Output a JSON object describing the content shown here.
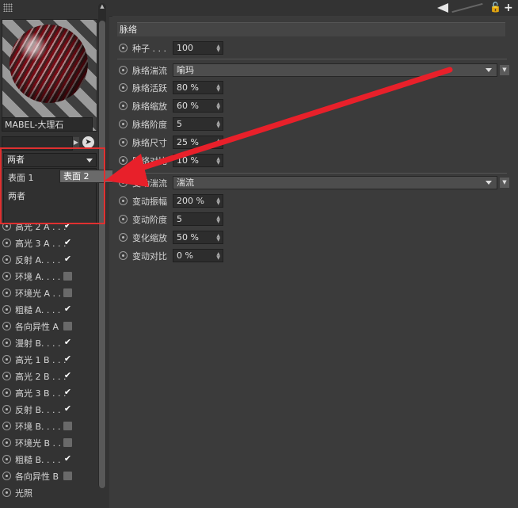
{
  "material": {
    "name": "MABEL-大理石"
  },
  "dropdown": {
    "value": "两者",
    "options": [
      {
        "label": "表面 1",
        "selected": false
      },
      {
        "label": "表面 2",
        "selected": true
      },
      {
        "label": "两者",
        "selected": false
      }
    ]
  },
  "channels": [
    {
      "label": "高光 2 A . . .",
      "checked": true
    },
    {
      "label": "高光 3 A . . .",
      "checked": true
    },
    {
      "label": "反射 A. . . .",
      "checked": true
    },
    {
      "label": "环境 A. . . .",
      "checked": false
    },
    {
      "label": "环境光 A . .",
      "checked": false
    },
    {
      "label": "粗糙 A. . . .",
      "checked": true
    },
    {
      "label": "各向异性 A",
      "checked": false
    },
    {
      "label": "漫射 B. . . .",
      "checked": true
    },
    {
      "label": "高光 1 B . . .",
      "checked": true
    },
    {
      "label": "高光 2 B . . .",
      "checked": true
    },
    {
      "label": "高光 3 B . . .",
      "checked": true
    },
    {
      "label": "反射 B. . . .",
      "checked": true
    },
    {
      "label": "环境 B. . . .",
      "checked": false
    },
    {
      "label": "环境光 B . .",
      "checked": false
    },
    {
      "label": "粗糙 B. . . .",
      "checked": true
    },
    {
      "label": "各向异性 B",
      "checked": false
    },
    {
      "label": "光照",
      "checked": null
    }
  ],
  "section": {
    "title": "脉络"
  },
  "seed": {
    "label": "种子 . . .",
    "value": "100"
  },
  "vein_noise": {
    "label": "脉络湍流",
    "value": "喻玛"
  },
  "vein_params": [
    {
      "label": "脉络活跃",
      "value": "80 %"
    },
    {
      "label": "脉络缩放",
      "value": "60 %"
    },
    {
      "label": "脉络阶度",
      "value": "5"
    },
    {
      "label": "脉络尺寸",
      "value": "25 %"
    },
    {
      "label": "脉络对比",
      "value": "10 %"
    }
  ],
  "var_noise": {
    "label": "变动湍流",
    "value": "湍流"
  },
  "var_params": [
    {
      "label": "变动振幅",
      "value": "200 %"
    },
    {
      "label": "变动阶度",
      "value": "5"
    },
    {
      "label": "变化缩放",
      "value": "50 %"
    },
    {
      "label": "变动对比",
      "value": "0 %"
    }
  ],
  "colors": {
    "highlight_box": "#e03030",
    "arrow": "#e8202a"
  }
}
